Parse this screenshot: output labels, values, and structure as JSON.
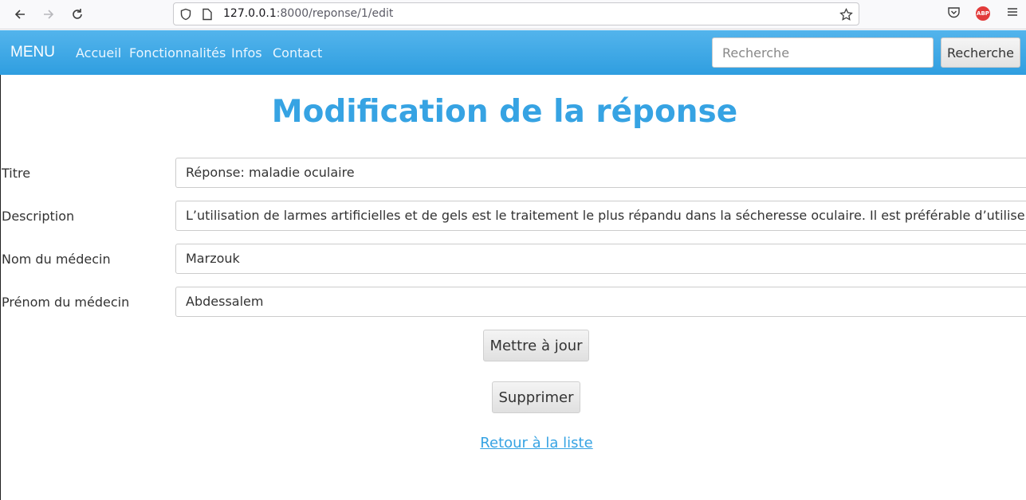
{
  "browser": {
    "url_host": "127.0.0.1",
    "url_path": ":8000/reponse/1/edit",
    "icons": [
      "back-icon",
      "forward-icon",
      "reload-icon",
      "shield-icon",
      "page-icon",
      "star-icon",
      "pocket-icon",
      "abp-icon",
      "menu-icon"
    ],
    "abp_label": "ABP"
  },
  "navbar": {
    "brand": "MENU",
    "links": [
      "Accueil",
      "Fonctionnalités",
      "Infos",
      "Contact"
    ],
    "search_placeholder": "Recherche",
    "search_button": "Recherche",
    "colors": {
      "bar": "#2f9ee0",
      "title": "#36a3e3"
    }
  },
  "main": {
    "title": "Modification de la réponse",
    "fields": [
      {
        "label": "Titre",
        "value": "Réponse: maladie oculaire"
      },
      {
        "label": "Description",
        "value": "L’utilisation de larmes artificielles et de gels est le traitement le plus répandu dans la sécheresse oculaire. Il est préférable d’utiliser des larmes ar"
      },
      {
        "label": "Nom du médecin",
        "value": "Marzouk"
      },
      {
        "label": "Prénom du médecin",
        "value": "Abdessalem"
      }
    ],
    "update_button": "Mettre à jour",
    "delete_button": "Supprimer",
    "back_link": "Retour à la liste"
  }
}
